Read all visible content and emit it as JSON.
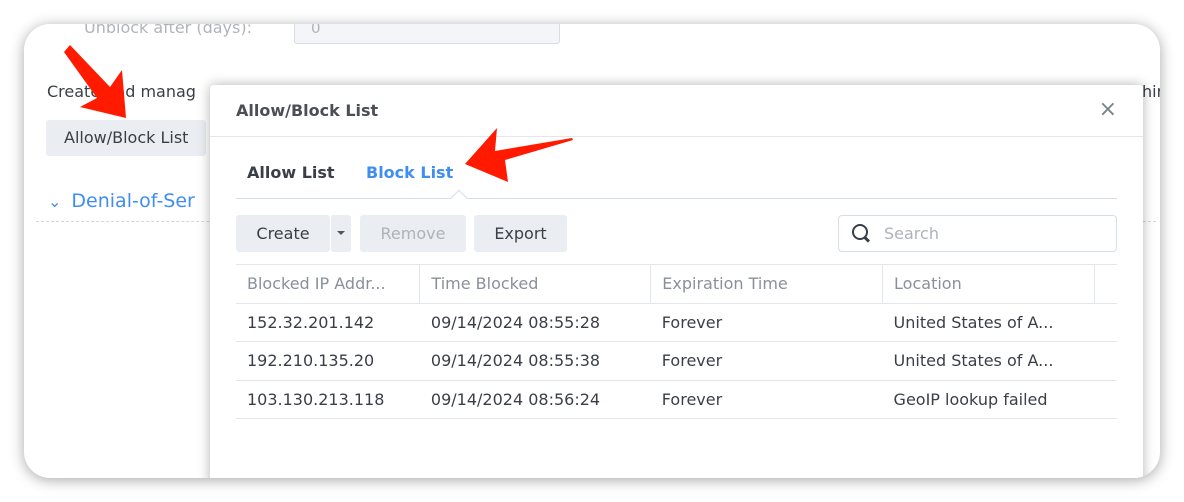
{
  "background": {
    "unblock_label": "Unblock after (days):",
    "unblock_value": "0",
    "description": "Create and manag",
    "description_right": "hir",
    "allow_block_button": "Allow/Block List",
    "section_title": "Denial-of-Ser"
  },
  "dialog": {
    "title": "Allow/Block List",
    "close": "×",
    "tabs": [
      {
        "label": "Allow List"
      },
      {
        "label": "Block List",
        "active": true
      }
    ],
    "toolbar": {
      "create": "Create",
      "remove": "Remove",
      "export": "Export",
      "search_placeholder": "Search"
    },
    "columns": [
      "Blocked IP Addr...",
      "Time Blocked",
      "Expiration Time",
      "Location"
    ],
    "rows": [
      [
        "152.32.201.142",
        "09/14/2024 08:55:28",
        "Forever",
        "United States of A..."
      ],
      [
        "192.210.135.20",
        "09/14/2024 08:55:38",
        "Forever",
        "United States of A..."
      ],
      [
        "103.130.213.118",
        "09/14/2024 08:56:24",
        "Forever",
        "GeoIP lookup failed"
      ]
    ]
  },
  "colors": {
    "accent": "#3f8ef0",
    "annotation_arrow": "#ff1a00"
  }
}
